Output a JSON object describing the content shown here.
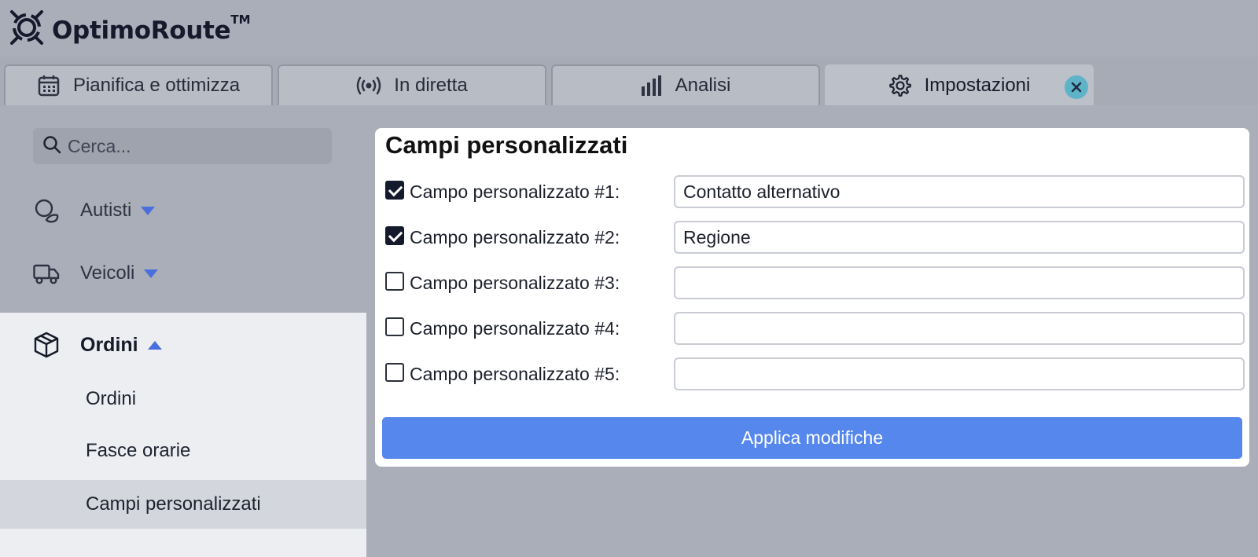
{
  "app": {
    "name": "OptimoRoute",
    "trademark": "TM"
  },
  "tabs": [
    {
      "label": "Pianifica e ottimizza",
      "icon": "calendar-icon"
    },
    {
      "label": "In diretta",
      "icon": "live-broadcast-icon"
    },
    {
      "label": "Analisi",
      "icon": "bar-chart-icon"
    },
    {
      "label": "Impostazioni",
      "icon": "gear-icon",
      "active": true
    }
  ],
  "search": {
    "placeholder": "Cerca..."
  },
  "sidebar": {
    "drivers": "Autisti",
    "vehicles": "Veicoli",
    "orders": "Ordini",
    "order_sub": [
      "Ordini",
      "Fasce orarie",
      "Campi personalizzati"
    ]
  },
  "content": {
    "title": "Campi personalizzati",
    "fields": [
      {
        "label": "Campo personalizzato #1:",
        "checked": true,
        "value": "Contatto alternativo"
      },
      {
        "label": "Campo personalizzato #2:",
        "checked": true,
        "value": "Regione"
      },
      {
        "label": "Campo personalizzato #3:",
        "checked": false,
        "value": ""
      },
      {
        "label": "Campo personalizzato #4:",
        "checked": false,
        "value": ""
      },
      {
        "label": "Campo personalizzato #5:",
        "checked": false,
        "value": ""
      }
    ],
    "apply_label": "Applica modifiche"
  },
  "colors": {
    "accent": "#5587ed",
    "close": "#5fb3c9",
    "caret": "#4a6fdc"
  }
}
